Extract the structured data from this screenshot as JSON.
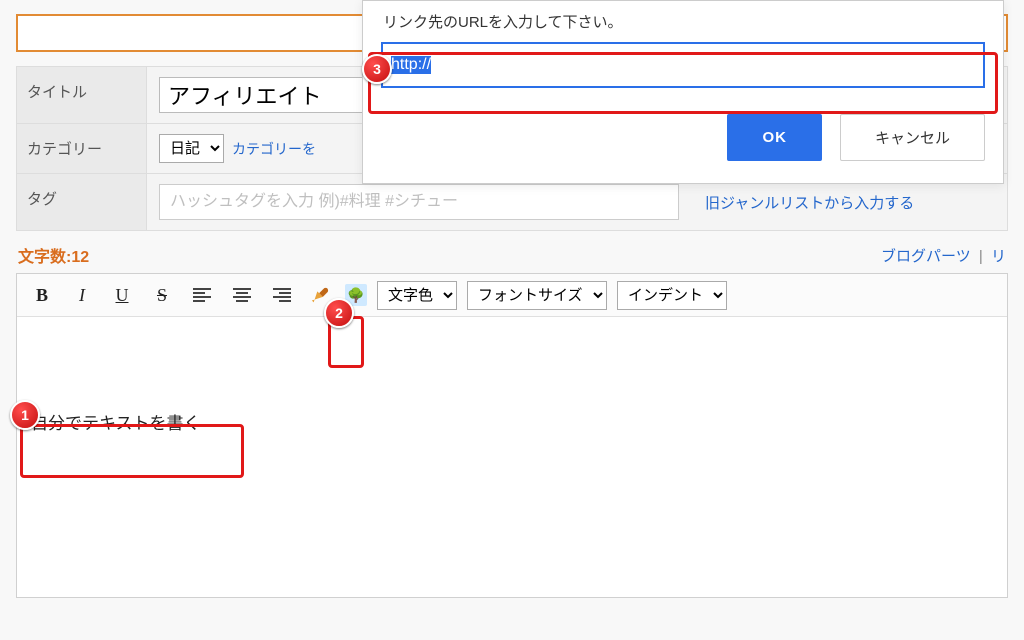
{
  "form": {
    "title_label": "タイトル",
    "title_value": "アフィリエイト",
    "category_label": "カテゴリー",
    "category_selected": "日記",
    "category_edit_link": "カテゴリーを",
    "tag_label": "タグ",
    "tag_placeholder": "ハッシュタグを入力 例)#料理 #シチュー",
    "genre_link": "旧ジャンルリストから入力する"
  },
  "counter": {
    "label": "文字数:",
    "value": "12"
  },
  "right_links": {
    "parts": "ブログパーツ",
    "sep": "|",
    "yo": "リ"
  },
  "toolbar": {
    "color_select": "文字色",
    "fontsize_select": "フォントサイズ",
    "indent_select": "インデント"
  },
  "editor": {
    "content": "自分でテキストを書く"
  },
  "dialog": {
    "message": "リンク先のURLを入力して下さい。",
    "input_value": "http://",
    "ok": "OK",
    "cancel": "キャンセル"
  },
  "annotations": {
    "b1": "1",
    "b2": "2",
    "b3": "3"
  }
}
